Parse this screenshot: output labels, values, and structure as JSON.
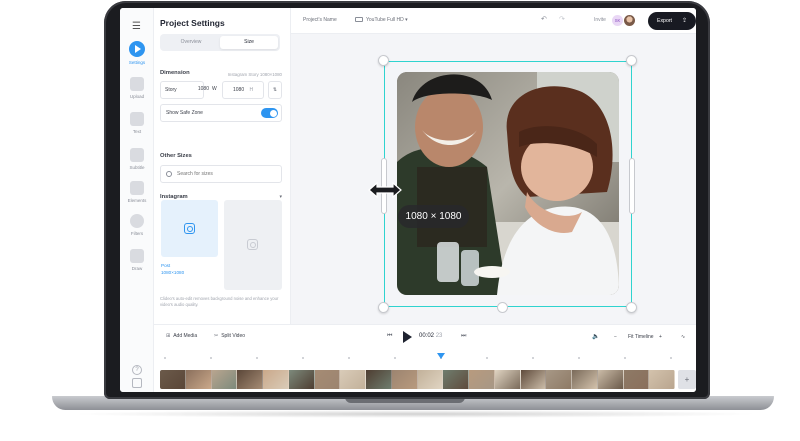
{
  "panel": {
    "title": "Project Settings",
    "tabs": [
      "Overview",
      "Size"
    ],
    "active_tab": "Size",
    "dimension": {
      "title": "Dimension",
      "note": "Instagram Story 1080×1080",
      "preset": "Story",
      "width": "1080",
      "width_unit": "W",
      "height": "1080",
      "height_unit": "H"
    },
    "safe_zone": {
      "label": "Show Safe Zone",
      "enabled": true
    },
    "other_sizes": {
      "title": "Other Sizes",
      "search_placeholder": "Search for sizes"
    },
    "instagram": {
      "title": "Instagram",
      "post_label": "Post",
      "post_size": "1080×1080"
    },
    "footer_note": "Clideo's auto-edit removes background noise and enhance your video's audio quality."
  },
  "rail": {
    "items": [
      "Settings",
      "Upload",
      "Text",
      "Subtitle",
      "Elements",
      "Filters",
      "Draw"
    ],
    "active": "Settings",
    "bottom_help": "?"
  },
  "topbar": {
    "project_name": "Project's Name",
    "format": "YouTube Full HD",
    "invite": "Invite",
    "user_initials": "SK",
    "export_label": "Export"
  },
  "canvas": {
    "dimension_badge": "1080 × 1080",
    "accent_color": "#2fd3cf"
  },
  "transport": {
    "add_media": "Add Media",
    "split_video": "Split Video",
    "time_current": "00:02",
    "time_total": "23",
    "zoom_label": "Fit Timeline"
  },
  "colors": {
    "brand_blue": "#2e95f0",
    "export_bg": "#181a22"
  }
}
